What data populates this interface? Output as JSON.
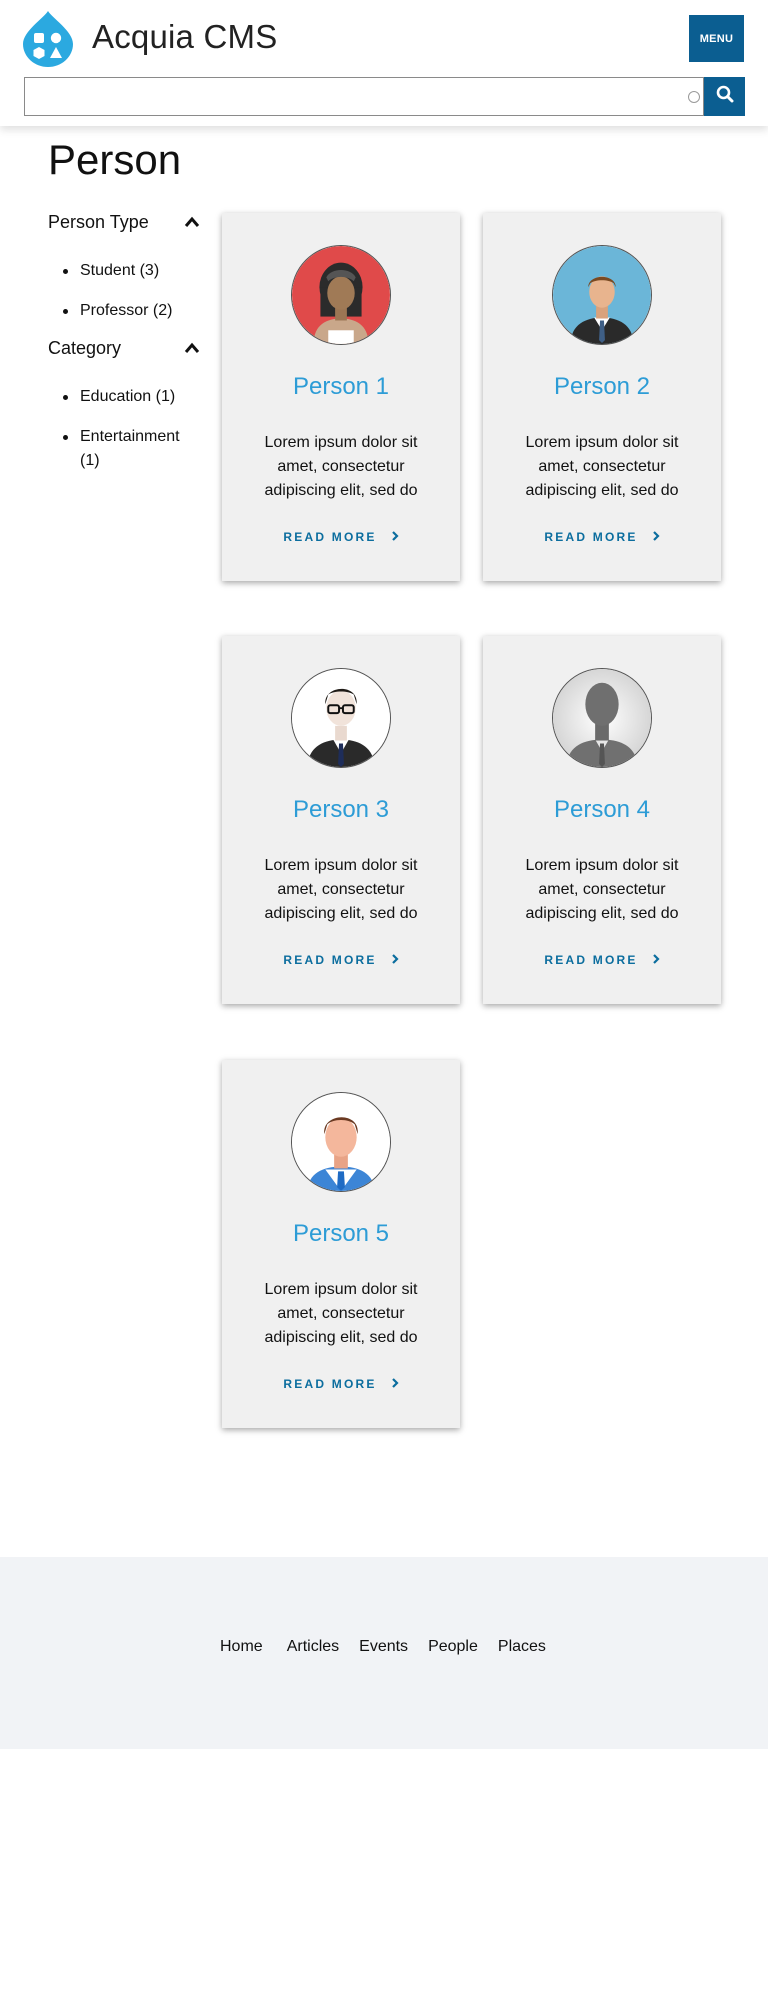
{
  "header": {
    "site_name": "Acquia CMS",
    "menu_label": "MENU",
    "search": {
      "value": "",
      "placeholder": ""
    }
  },
  "page": {
    "title": "Person"
  },
  "facets": [
    {
      "heading": "Person Type",
      "items": [
        "Student (3)",
        "Professor (2)"
      ]
    },
    {
      "heading": "Category",
      "items": [
        "Education (1)",
        "Entertainment (1)"
      ]
    }
  ],
  "cards": [
    {
      "name": "Person 1",
      "text": "Lorem ipsum dolor sit amet, consectetur adipiscing elit, sed do",
      "link": "READ MORE"
    },
    {
      "name": "Person 2",
      "text": "Lorem ipsum dolor sit amet, consectetur adipiscing elit, sed do",
      "link": "READ MORE"
    },
    {
      "name": "Person 3",
      "text": "Lorem ipsum dolor sit amet, consectetur adipiscing elit, sed do",
      "link": "READ MORE"
    },
    {
      "name": "Person 4",
      "text": "Lorem ipsum dolor sit amet, consectetur adipiscing elit, sed do",
      "link": "READ MORE"
    },
    {
      "name": "Person 5",
      "text": "Lorem ipsum dolor sit amet, consectetur adipiscing elit, sed do",
      "link": "READ MORE"
    }
  ],
  "footer": {
    "nav": [
      "Home",
      "Articles",
      "Events",
      "People",
      "Places"
    ]
  },
  "icons": {
    "logo": "drupal-logo-icon",
    "search": "search-icon",
    "facet_toggle": "chevron-up-icon",
    "read_more": "chevron-right-icon"
  },
  "colors": {
    "brand": "#0b5e91",
    "logo": "#2ba9e0",
    "card_title": "#2d9cd6",
    "link": "#0b6d9e",
    "card_bg": "#f0f0f0",
    "footer_bg": "#f1f3f6"
  }
}
